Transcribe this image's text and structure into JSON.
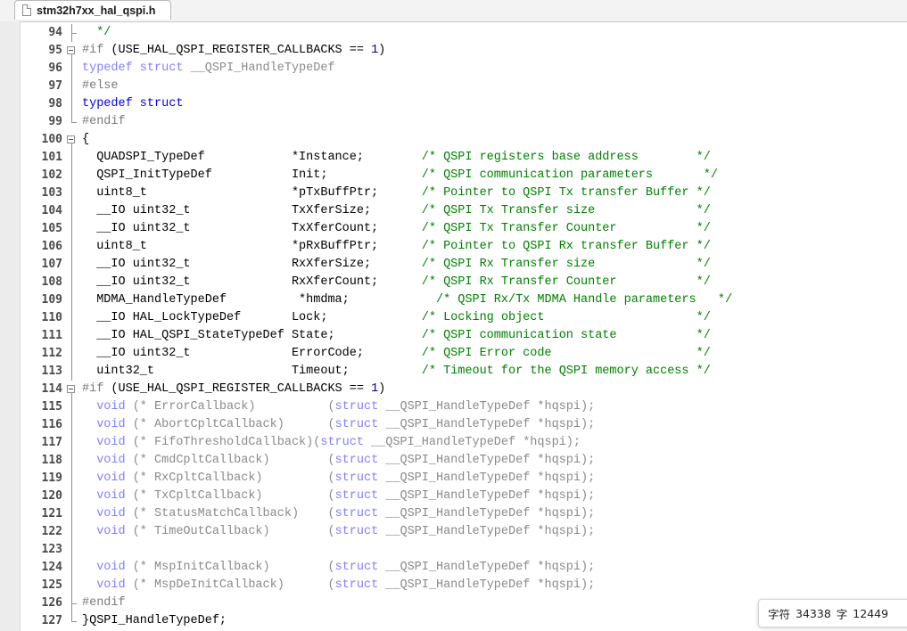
{
  "tab": {
    "filename": "stm32h7xx_hal_qspi.h"
  },
  "status": {
    "char_label": "字符",
    "char_count": "34338",
    "word_label": "字",
    "word_count": "12449",
    "tail": " "
  },
  "colors": {
    "keyword": "#0000e6",
    "preprocessor": "#7a7a7a",
    "comment": "#008000",
    "number": "#000080",
    "identifier": "#000000",
    "greyed_keyword": "#8080ff",
    "greyed": "#8a8a8a"
  },
  "lines": [
    {
      "num": "94",
      "fold": "end-mid",
      "tokens": [
        [
          "cm",
          "  */"
        ]
      ]
    },
    {
      "num": "95",
      "fold": "open",
      "tokens": [
        [
          "pp",
          "#if"
        ],
        [
          "op",
          " (USE_HAL_QSPI_REGISTER_CALLBACKS == "
        ],
        [
          "num",
          "1"
        ],
        [
          "op",
          ")"
        ]
      ]
    },
    {
      "num": "96",
      "fold": "line",
      "tokens": [
        [
          "gk",
          "typedef struct"
        ],
        [
          "g",
          " __QSPI_HandleTypeDef"
        ]
      ]
    },
    {
      "num": "97",
      "fold": "line",
      "tokens": [
        [
          "pp",
          "#else"
        ]
      ]
    },
    {
      "num": "98",
      "fold": "line",
      "tokens": [
        [
          "kw",
          "typedef struct"
        ]
      ]
    },
    {
      "num": "99",
      "fold": "end",
      "tokens": [
        [
          "pp",
          "#endif"
        ]
      ]
    },
    {
      "num": "100",
      "fold": "open",
      "tokens": [
        [
          "op",
          "{"
        ]
      ]
    },
    {
      "num": "101",
      "fold": "line",
      "tokens": [
        [
          "id",
          "  QUADSPI_TypeDef            *Instance;        "
        ],
        [
          "cm",
          "/* QSPI registers base address        */"
        ]
      ]
    },
    {
      "num": "102",
      "fold": "line",
      "tokens": [
        [
          "id",
          "  QSPI_InitTypeDef           Init;             "
        ],
        [
          "cm",
          "/* QSPI communication parameters       */"
        ]
      ]
    },
    {
      "num": "103",
      "fold": "line",
      "tokens": [
        [
          "id",
          "  uint8_t                    *pTxBuffPtr;      "
        ],
        [
          "cm",
          "/* Pointer to QSPI Tx transfer Buffer */"
        ]
      ]
    },
    {
      "num": "104",
      "fold": "line",
      "tokens": [
        [
          "id",
          "  __IO uint32_t              TxXferSize;       "
        ],
        [
          "cm",
          "/* QSPI Tx Transfer size              */"
        ]
      ]
    },
    {
      "num": "105",
      "fold": "line",
      "tokens": [
        [
          "id",
          "  __IO uint32_t              TxXferCount;      "
        ],
        [
          "cm",
          "/* QSPI Tx Transfer Counter           */"
        ]
      ]
    },
    {
      "num": "106",
      "fold": "line",
      "tokens": [
        [
          "id",
          "  uint8_t                    *pRxBuffPtr;      "
        ],
        [
          "cm",
          "/* Pointer to QSPI Rx transfer Buffer */"
        ]
      ]
    },
    {
      "num": "107",
      "fold": "line",
      "tokens": [
        [
          "id",
          "  __IO uint32_t              RxXferSize;       "
        ],
        [
          "cm",
          "/* QSPI Rx Transfer size              */"
        ]
      ]
    },
    {
      "num": "108",
      "fold": "line",
      "tokens": [
        [
          "id",
          "  __IO uint32_t              RxXferCount;      "
        ],
        [
          "cm",
          "/* QSPI Rx Transfer Counter           */"
        ]
      ]
    },
    {
      "num": "109",
      "fold": "line",
      "tokens": [
        [
          "id",
          "  MDMA_HandleTypeDef          *hmdma;            "
        ],
        [
          "cm",
          "/* QSPI Rx/Tx MDMA Handle parameters   */"
        ]
      ]
    },
    {
      "num": "110",
      "fold": "line",
      "tokens": [
        [
          "id",
          "  __IO HAL_LockTypeDef       Lock;             "
        ],
        [
          "cm",
          "/* Locking object                     */"
        ]
      ]
    },
    {
      "num": "111",
      "fold": "line",
      "tokens": [
        [
          "id",
          "  __IO HAL_QSPI_StateTypeDef State;            "
        ],
        [
          "cm",
          "/* QSPI communication state           */"
        ]
      ]
    },
    {
      "num": "112",
      "fold": "line",
      "tokens": [
        [
          "id",
          "  __IO uint32_t              ErrorCode;        "
        ],
        [
          "cm",
          "/* QSPI Error code                    */"
        ]
      ]
    },
    {
      "num": "113",
      "fold": "line",
      "tokens": [
        [
          "id",
          "  uint32_t                   Timeout;          "
        ],
        [
          "cm",
          "/* Timeout for the QSPI memory access */"
        ]
      ]
    },
    {
      "num": "114",
      "fold": "open",
      "tokens": [
        [
          "pp",
          "#if"
        ],
        [
          "op",
          " (USE_HAL_QSPI_REGISTER_CALLBACKS == "
        ],
        [
          "num",
          "1"
        ],
        [
          "op",
          ")"
        ]
      ]
    },
    {
      "num": "115",
      "fold": "line",
      "tokens": [
        [
          "gk",
          "  void"
        ],
        [
          "g",
          " (* ErrorCallback)          ("
        ],
        [
          "gk",
          "struct"
        ],
        [
          "g",
          " __QSPI_HandleTypeDef *hqspi);"
        ]
      ]
    },
    {
      "num": "116",
      "fold": "line",
      "tokens": [
        [
          "gk",
          "  void"
        ],
        [
          "g",
          " (* AbortCpltCallback)      ("
        ],
        [
          "gk",
          "struct"
        ],
        [
          "g",
          " __QSPI_HandleTypeDef *hqspi);"
        ]
      ]
    },
    {
      "num": "117",
      "fold": "line",
      "tokens": [
        [
          "gk",
          "  void"
        ],
        [
          "g",
          " (* FifoThresholdCallback)("
        ],
        [
          "gk",
          "struct"
        ],
        [
          "g",
          " __QSPI_HandleTypeDef *hqspi);"
        ]
      ]
    },
    {
      "num": "118",
      "fold": "line",
      "tokens": [
        [
          "gk",
          "  void"
        ],
        [
          "g",
          " (* CmdCpltCallback)        ("
        ],
        [
          "gk",
          "struct"
        ],
        [
          "g",
          " __QSPI_HandleTypeDef *hqspi);"
        ]
      ]
    },
    {
      "num": "119",
      "fold": "line",
      "tokens": [
        [
          "gk",
          "  void"
        ],
        [
          "g",
          " (* RxCpltCallback)         ("
        ],
        [
          "gk",
          "struct"
        ],
        [
          "g",
          " __QSPI_HandleTypeDef *hqspi);"
        ]
      ]
    },
    {
      "num": "120",
      "fold": "line",
      "tokens": [
        [
          "gk",
          "  void"
        ],
        [
          "g",
          " (* TxCpltCallback)         ("
        ],
        [
          "gk",
          "struct"
        ],
        [
          "g",
          " __QSPI_HandleTypeDef *hqspi);"
        ]
      ]
    },
    {
      "num": "121",
      "fold": "line",
      "tokens": [
        [
          "gk",
          "  void"
        ],
        [
          "g",
          " (* StatusMatchCallback)    ("
        ],
        [
          "gk",
          "struct"
        ],
        [
          "g",
          " __QSPI_HandleTypeDef *hqspi);"
        ]
      ]
    },
    {
      "num": "122",
      "fold": "line",
      "tokens": [
        [
          "gk",
          "  void"
        ],
        [
          "g",
          " (* TimeOutCallback)        ("
        ],
        [
          "gk",
          "struct"
        ],
        [
          "g",
          " __QSPI_HandleTypeDef *hqspi);"
        ]
      ]
    },
    {
      "num": "123",
      "fold": "line",
      "tokens": []
    },
    {
      "num": "124",
      "fold": "line",
      "tokens": [
        [
          "gk",
          "  void"
        ],
        [
          "g",
          " (* MspInitCallback)        ("
        ],
        [
          "gk",
          "struct"
        ],
        [
          "g",
          " __QSPI_HandleTypeDef *hqspi);"
        ]
      ]
    },
    {
      "num": "125",
      "fold": "line",
      "tokens": [
        [
          "gk",
          "  void"
        ],
        [
          "g",
          " (* MspDeInitCallback)      ("
        ],
        [
          "gk",
          "struct"
        ],
        [
          "g",
          " __QSPI_HandleTypeDef *hqspi);"
        ]
      ]
    },
    {
      "num": "126",
      "fold": "end-mid",
      "tokens": [
        [
          "pp",
          "#endif"
        ]
      ]
    },
    {
      "num": "127",
      "fold": "end",
      "tokens": [
        [
          "op",
          "}QSPI_HandleTypeDef;"
        ]
      ]
    }
  ]
}
